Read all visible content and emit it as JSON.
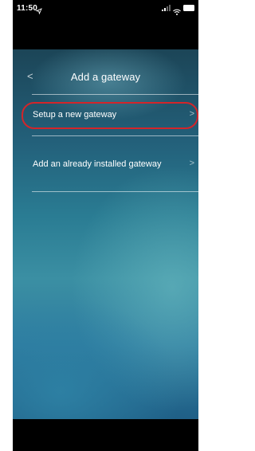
{
  "status_bar": {
    "time": "11:50",
    "location_icon": "location-arrow-icon",
    "signal_icon": "cellular-signal-icon",
    "wifi_icon": "wifi-icon",
    "battery_icon": "battery-icon"
  },
  "nav": {
    "back_icon": "chevron-left-icon",
    "back_glyph": "<",
    "title": "Add a gateway"
  },
  "menu": {
    "items": [
      {
        "label": "Setup a new gateway",
        "chevron": ">"
      },
      {
        "label": "Add an already installed gateway",
        "chevron": ">"
      }
    ]
  },
  "annotation": {
    "highlight_color": "#d3252a"
  },
  "colors": {
    "background_top": "#1c4557",
    "background_mid": "#2a7c93",
    "background_bottom": "#1f5f86",
    "text": "#ffffff"
  }
}
